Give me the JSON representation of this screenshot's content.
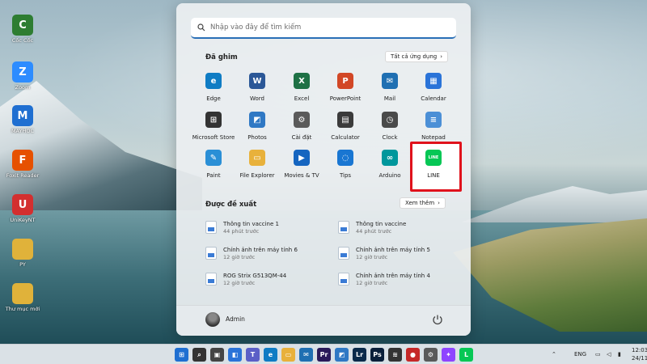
{
  "desktop": {
    "icons": [
      {
        "label": "Cốc Cốc",
        "color": "#2e7d32",
        "glyph": "C"
      },
      {
        "label": "Zoom",
        "color": "#2d8cff",
        "glyph": "Z"
      },
      {
        "label": "MAYHOC",
        "color": "#1f6fd1",
        "glyph": "M"
      },
      {
        "label": "Foxit Reader",
        "color": "#e65100",
        "glyph": "F"
      },
      {
        "label": "UniKeyNT",
        "color": "#d32f2f",
        "glyph": "U"
      },
      {
        "label": "PY",
        "color": "#e0b23a",
        "glyph": ""
      },
      {
        "label": "Thư mục mới",
        "color": "#e0b23a",
        "glyph": ""
      }
    ]
  },
  "start_menu": {
    "search_placeholder": "Nhập vào đây để tìm kiếm",
    "pinned_title": "Đã ghim",
    "all_apps_label": "Tất cả ứng dụng",
    "pinned_apps": [
      {
        "label": "Edge",
        "color": "#0f7cc4",
        "glyph": "e"
      },
      {
        "label": "Word",
        "color": "#2b5797",
        "glyph": "W"
      },
      {
        "label": "Excel",
        "color": "#1e7145",
        "glyph": "X"
      },
      {
        "label": "PowerPoint",
        "color": "#d24726",
        "glyph": "P"
      },
      {
        "label": "Mail",
        "color": "#1f6fb2",
        "glyph": "✉"
      },
      {
        "label": "Calendar",
        "color": "#2a73d8",
        "glyph": "▦"
      },
      {
        "label": "Microsoft Store",
        "color": "#333333",
        "glyph": "⊞"
      },
      {
        "label": "Photos",
        "color": "#2f78c4",
        "glyph": "◩"
      },
      {
        "label": "Cài đặt",
        "color": "#5a5a5a",
        "glyph": "⚙"
      },
      {
        "label": "Calculator",
        "color": "#3b3b3b",
        "glyph": "▤"
      },
      {
        "label": "Clock",
        "color": "#4a4a4a",
        "glyph": "◷"
      },
      {
        "label": "Notepad",
        "color": "#4b8fd6",
        "glyph": "≡"
      },
      {
        "label": "Paint",
        "color": "#2a8fd6",
        "glyph": "✎"
      },
      {
        "label": "File Explorer",
        "color": "#e8b13b",
        "glyph": "▭"
      },
      {
        "label": "Movies & TV",
        "color": "#1565c0",
        "glyph": "▶"
      },
      {
        "label": "Tips",
        "color": "#1976d2",
        "glyph": "◌"
      },
      {
        "label": "Arduino",
        "color": "#00979c",
        "glyph": "∞"
      },
      {
        "label": "LINE",
        "color": "#06c755",
        "glyph": "LINE"
      }
    ],
    "recommended_title": "Được đề xuất",
    "more_label": "Xem thêm",
    "recommended": [
      {
        "title": "Thông tin vaccine 1",
        "time": "44 phút trước"
      },
      {
        "title": "Thông tin vaccine",
        "time": "44 phút trước"
      },
      {
        "title": "Chính ảnh trên máy tính 6",
        "time": "12 giờ trước"
      },
      {
        "title": "Chính ảnh trên máy tính 5",
        "time": "12 giờ trước"
      },
      {
        "title": "ROG Strix G513QM-44",
        "time": "12 giờ trước"
      },
      {
        "title": "Chính ảnh trên máy tính 4",
        "time": "12 giờ trước"
      }
    ],
    "user_name": "Admin"
  },
  "taskbar": {
    "apps": [
      {
        "name": "windows",
        "color": "#1f6fd1",
        "glyph": "⊞"
      },
      {
        "name": "search",
        "color": "#333333",
        "glyph": "⌕"
      },
      {
        "name": "task-view",
        "color": "#444444",
        "glyph": "▣"
      },
      {
        "name": "widgets",
        "color": "#2a73d8",
        "glyph": "◧"
      },
      {
        "name": "teams",
        "color": "#5b5fc7",
        "glyph": "T"
      },
      {
        "name": "edge",
        "color": "#0f7cc4",
        "glyph": "e"
      },
      {
        "name": "file-explorer",
        "color": "#e8b13b",
        "glyph": "▭"
      },
      {
        "name": "mail",
        "color": "#1f6fb2",
        "glyph": "✉"
      },
      {
        "name": "premiere",
        "color": "#2a1a5a",
        "glyph": "Pr"
      },
      {
        "name": "photos",
        "color": "#2f78c4",
        "glyph": "◩"
      },
      {
        "name": "lightroom",
        "color": "#0a2a4a",
        "glyph": "Lr"
      },
      {
        "name": "photoshop",
        "color": "#0a1f3a",
        "glyph": "Ps"
      },
      {
        "name": "stack",
        "color": "#333333",
        "glyph": "≋"
      },
      {
        "name": "app-red",
        "color": "#c62828",
        "glyph": "●"
      },
      {
        "name": "settings",
        "color": "#5a5a5a",
        "glyph": "⚙"
      },
      {
        "name": "messenger",
        "color": "#8e44ff",
        "glyph": "✦"
      },
      {
        "name": "line",
        "color": "#06c755",
        "glyph": "L"
      }
    ],
    "language": "ENG",
    "time": "12:03",
    "date": "24/11/"
  }
}
